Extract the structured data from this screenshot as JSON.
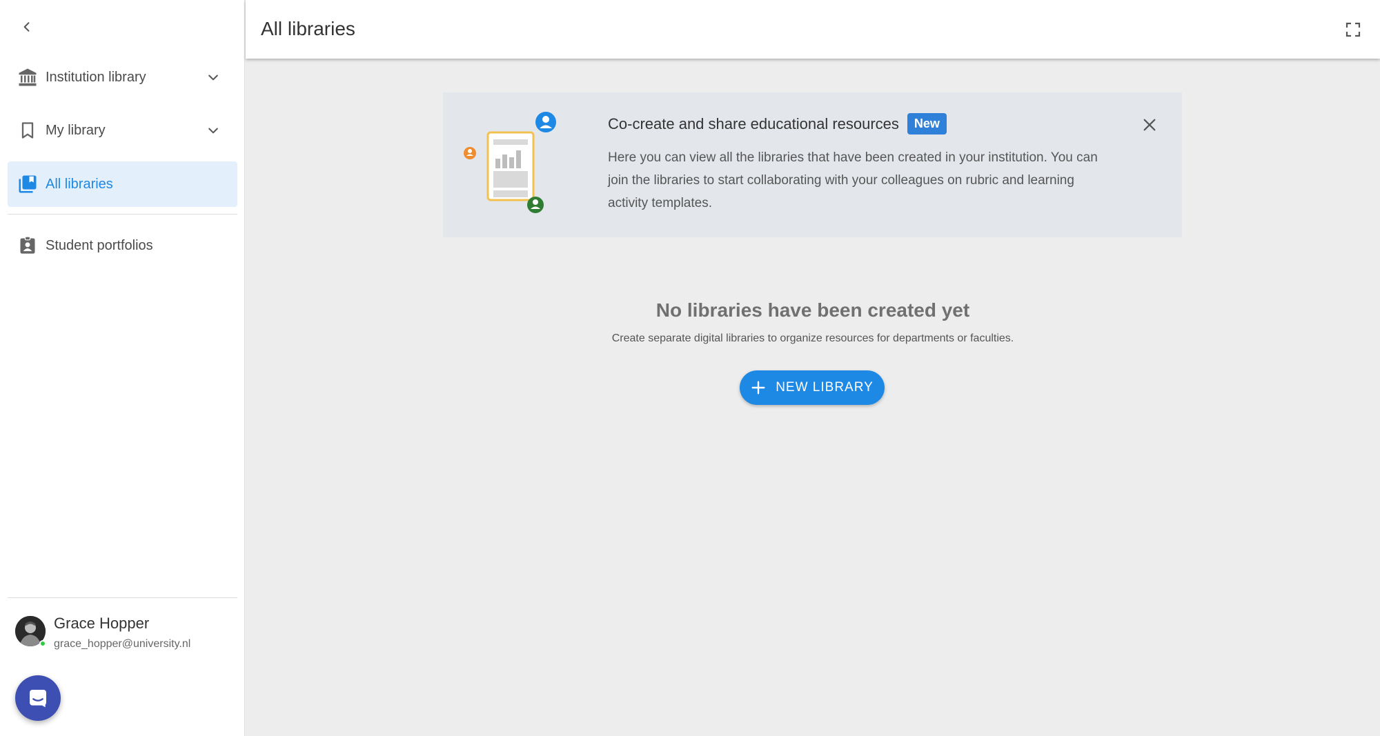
{
  "sidebar": {
    "items": [
      {
        "label": "Institution library",
        "icon": "institution-icon",
        "expandable": true
      },
      {
        "label": "My library",
        "icon": "bookmark-icon",
        "expandable": true
      },
      {
        "label": "All libraries",
        "icon": "libraries-icon",
        "active": true
      },
      {
        "label": "Student portfolios",
        "icon": "portfolio-icon"
      }
    ],
    "user": {
      "name": "Grace Hopper",
      "email": "grace_hopper@university.nl",
      "status": "online"
    }
  },
  "header": {
    "title": "All libraries"
  },
  "banner": {
    "title": "Co-create and share educational resources",
    "badge": "New",
    "body": "Here you can view all the libraries that have been created in your institution. You can join the libraries to start collaborating with your colleagues on rubric and learning activity templates."
  },
  "empty_state": {
    "title": "No libraries have been created yet",
    "subtitle": "Create separate digital libraries to organize resources for departments or faculties.",
    "button_label": "NEW LIBRARY"
  },
  "colors": {
    "accent": "#1e88e5",
    "active_bg": "#e3f0fb",
    "badge": "#2f80d9",
    "chat_button": "#3d4fb3",
    "background": "#ededed"
  }
}
